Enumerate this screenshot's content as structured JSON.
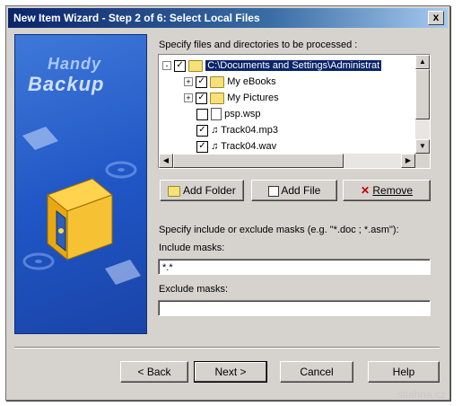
{
  "window": {
    "title": "New Item Wizard - Step 2 of 6: Select Local Files",
    "close_label": "x"
  },
  "banner": {
    "logo_line1": "Handy",
    "logo_line2": "Backup"
  },
  "files": {
    "label": "Specify files and directories to be processed :",
    "tree": [
      {
        "label": "C:\\Documents and Settings\\Administrat",
        "checked": true,
        "type": "folder",
        "expander": "-",
        "selected": true
      },
      {
        "label": "My eBooks",
        "checked": true,
        "type": "folder",
        "expander": "+"
      },
      {
        "label": "My Pictures",
        "checked": true,
        "type": "folder",
        "expander": "+"
      },
      {
        "label": "psp.wsp",
        "checked": false,
        "type": "file"
      },
      {
        "label": "Track04.mp3",
        "checked": true,
        "type": "audio"
      },
      {
        "label": "Track04.wav",
        "checked": true,
        "type": "audio"
      }
    ]
  },
  "buttons": {
    "add_folder": "Add Folder",
    "add_file": "Add File",
    "remove": "Remove",
    "back": "< Back",
    "next": "Next >",
    "cancel": "Cancel",
    "help": "Help"
  },
  "masks": {
    "description": "Specify include or exclude masks (e.g. \"*.doc ; *.asm\"):",
    "include_label": "Include masks:",
    "include_value": "*.*",
    "exclude_label": "Exclude masks:",
    "exclude_value": ""
  },
  "watermark": "stiahna.cz",
  "colors": {
    "title_bar": "#0a246a",
    "banner": "#1f55c4",
    "dialog": "#d6d3ce",
    "selection": "#0a246a"
  }
}
